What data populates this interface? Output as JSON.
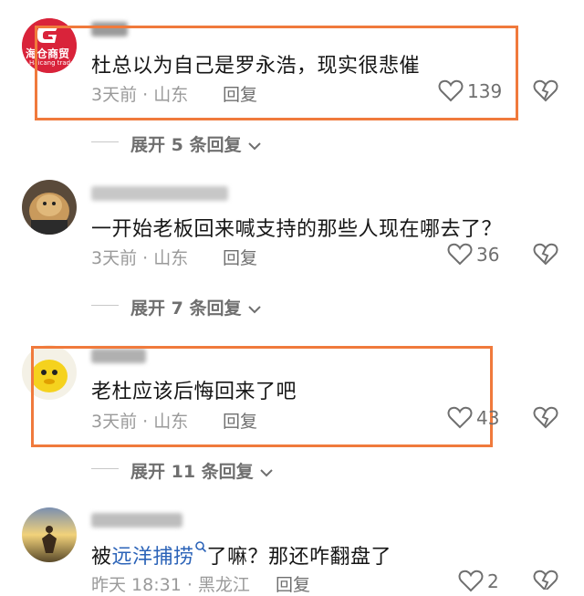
{
  "comments": [
    {
      "avatar_text": "海仓商贸",
      "avatar_sub": "Haicang trade",
      "text": "杜总以为自己是罗永浩，现实很悲催",
      "meta": "3天前 · 山东",
      "reply": "回复",
      "likes": "139",
      "expand": "展开 5 条回复"
    },
    {
      "text": "一开始老板回来喊支持的那些人现在哪去了？",
      "meta": "3天前 · 山东",
      "reply": "回复",
      "likes": "36",
      "expand": "展开 7 条回复"
    },
    {
      "text": "老杜应该后悔回来了吧",
      "meta": "3天前 · 山东",
      "reply": "回复",
      "likes": "43",
      "expand": "展开 11 条回复"
    },
    {
      "text_prefix": "被",
      "text_link": "远洋捕捞",
      "text_suffix": "了嘛？那还咋翻盘了",
      "meta": "昨天 18:31 · 黑龙江",
      "reply": "回复",
      "likes": "2"
    }
  ],
  "colors": {
    "highlight": "#f07a3c",
    "link": "#2b63b8"
  }
}
